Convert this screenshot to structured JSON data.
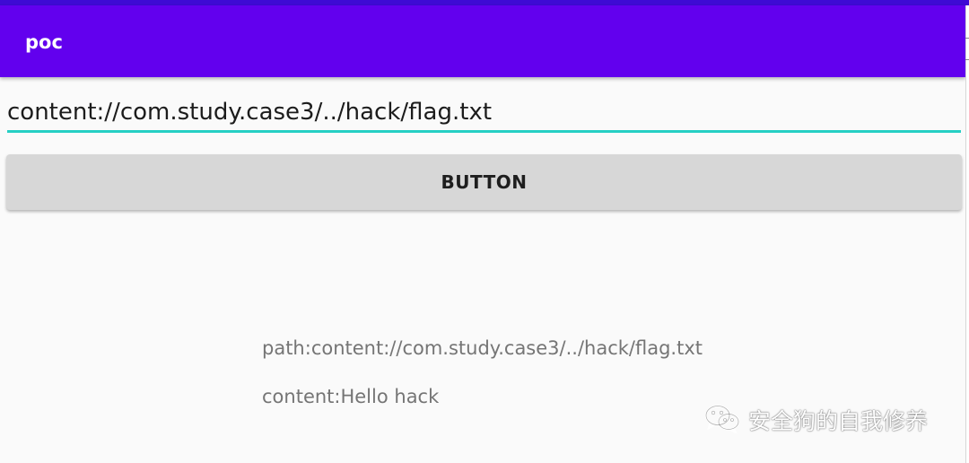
{
  "app_bar": {
    "title": "poc",
    "color": "#6200ee",
    "status_bar_color": "#3e0ad4"
  },
  "input": {
    "value": "content://com.study.case3/../hack/flag.txt",
    "underline_color": "#26cfc4"
  },
  "button": {
    "label": "BUTTON"
  },
  "output": {
    "path_line": "path:content://com.study.case3/../hack/flag.txt",
    "content_line": "content:Hello hack"
  },
  "watermark": {
    "icon": "wechat-icon",
    "text": "安全狗的自我修养"
  }
}
